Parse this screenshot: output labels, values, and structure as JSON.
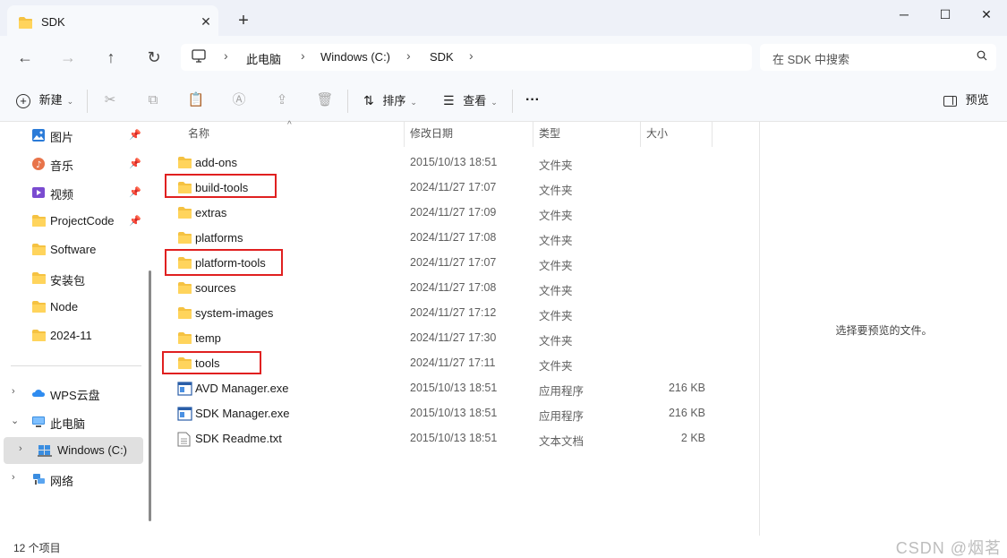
{
  "window": {
    "tab_title": "SDK",
    "new_tab": "+",
    "tab_close": "✕",
    "minimize": "─",
    "maximize": "☐",
    "close": "✕"
  },
  "address": {
    "crumbs": [
      "此电脑",
      "Windows (C:)",
      "SDK"
    ],
    "search_placeholder": "在 SDK 中搜索"
  },
  "toolbar": {
    "new_label": "新建",
    "sort_label": "排序",
    "view_label": "查看",
    "more_label": "···",
    "preview_label": "预览"
  },
  "sidebar": {
    "quick_access": [
      {
        "label": "图片",
        "icon": "pictures-icon",
        "pinned": true
      },
      {
        "label": "音乐",
        "icon": "music-icon",
        "pinned": true
      },
      {
        "label": "视频",
        "icon": "video-icon",
        "pinned": true
      },
      {
        "label": "ProjectCode",
        "icon": "folder-icon",
        "pinned": true
      },
      {
        "label": "Software",
        "icon": "folder-icon",
        "pinned": false
      },
      {
        "label": "安装包",
        "icon": "folder-icon",
        "pinned": false
      },
      {
        "label": "Node",
        "icon": "folder-icon",
        "pinned": false
      },
      {
        "label": "2024-11",
        "icon": "folder-icon",
        "pinned": false
      }
    ],
    "tree": [
      {
        "label": "WPS云盘",
        "icon": "cloud-icon",
        "chevron": "›"
      },
      {
        "label": "此电脑",
        "icon": "computer-icon",
        "chevron": "⌄"
      },
      {
        "label": "Windows (C:)",
        "icon": "drive-icon",
        "chevron": "›"
      },
      {
        "label": "网络",
        "icon": "network-icon",
        "chevron": "›"
      }
    ]
  },
  "columns": {
    "name": "名称",
    "date": "修改日期",
    "type": "类型",
    "size": "大小"
  },
  "files": [
    {
      "name": "add-ons",
      "date": "2015/10/13 18:51",
      "type": "文件夹",
      "size": "",
      "icon": "folder-icon",
      "highlighted": false
    },
    {
      "name": "build-tools",
      "date": "2024/11/27 17:07",
      "type": "文件夹",
      "size": "",
      "icon": "folder-icon",
      "highlighted": true
    },
    {
      "name": "extras",
      "date": "2024/11/27 17:09",
      "type": "文件夹",
      "size": "",
      "icon": "folder-icon",
      "highlighted": false
    },
    {
      "name": "platforms",
      "date": "2024/11/27 17:08",
      "type": "文件夹",
      "size": "",
      "icon": "folder-icon",
      "highlighted": false
    },
    {
      "name": "platform-tools",
      "date": "2024/11/27 17:07",
      "type": "文件夹",
      "size": "",
      "icon": "folder-icon",
      "highlighted": true
    },
    {
      "name": "sources",
      "date": "2024/11/27 17:08",
      "type": "文件夹",
      "size": "",
      "icon": "folder-icon",
      "highlighted": false
    },
    {
      "name": "system-images",
      "date": "2024/11/27 17:12",
      "type": "文件夹",
      "size": "",
      "icon": "folder-icon",
      "highlighted": false
    },
    {
      "name": "temp",
      "date": "2024/11/27 17:30",
      "type": "文件夹",
      "size": "",
      "icon": "folder-icon",
      "highlighted": false
    },
    {
      "name": "tools",
      "date": "2024/11/27 17:11",
      "type": "文件夹",
      "size": "",
      "icon": "folder-icon",
      "highlighted": true
    },
    {
      "name": "AVD Manager.exe",
      "date": "2015/10/13 18:51",
      "type": "应用程序",
      "size": "216 KB",
      "icon": "exe-icon",
      "highlighted": false
    },
    {
      "name": "SDK Manager.exe",
      "date": "2015/10/13 18:51",
      "type": "应用程序",
      "size": "216 KB",
      "icon": "exe-icon",
      "highlighted": false
    },
    {
      "name": "SDK Readme.txt",
      "date": "2015/10/13 18:51",
      "type": "文本文档",
      "size": "2 KB",
      "icon": "text-file-icon",
      "highlighted": false
    }
  ],
  "preview": {
    "empty_text": "选择要预览的文件。"
  },
  "status": {
    "item_count": "12 个项目",
    "watermark": "CSDN @烟茗"
  },
  "colors": {
    "folder": "#f5c242",
    "highlight": "#e02020",
    "chrome_bg": "#eef1f8"
  }
}
